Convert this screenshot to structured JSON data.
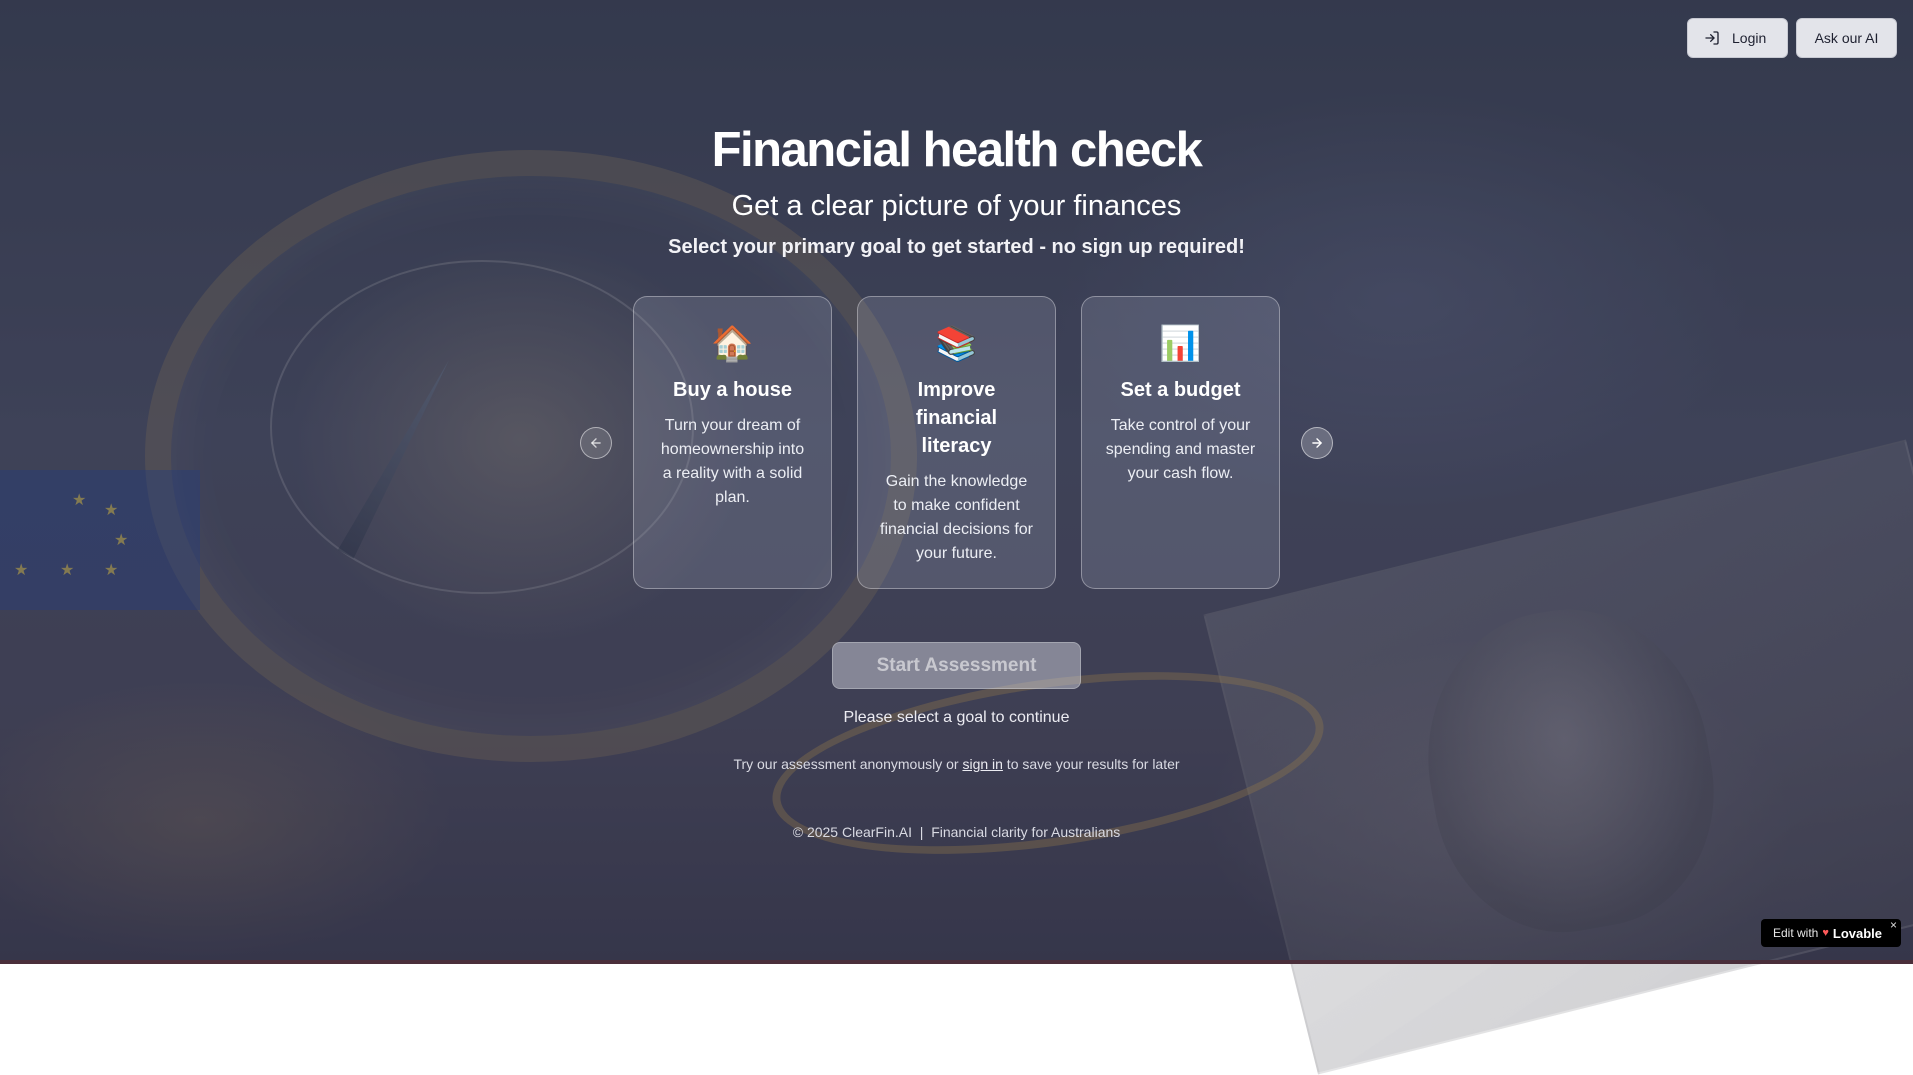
{
  "header": {
    "login_label": "Login",
    "ask_ai_label": "Ask our AI"
  },
  "hero": {
    "title": "Financial health check",
    "subtitle": "Get a clear picture of your finances",
    "instruction": "Select your primary goal to get started - no sign up required!"
  },
  "goals": [
    {
      "icon": "house-icon",
      "emoji": "🏠",
      "title": "Buy a house",
      "description": "Turn your dream of homeownership into a reality with a solid plan."
    },
    {
      "icon": "books-icon",
      "emoji": "📚",
      "title": "Improve financial literacy",
      "description": "Gain the knowledge to make confident financial decisions for your future."
    },
    {
      "icon": "bar-chart-icon",
      "emoji": "📊",
      "title": "Set a budget",
      "description": "Take control of your spending and master your cash flow."
    }
  ],
  "carousel": {
    "prev_icon": "arrow-left-icon",
    "next_icon": "arrow-right-icon"
  },
  "cta": {
    "start_label": "Start Assessment",
    "hint": "Please select a goal to continue"
  },
  "anon_note": {
    "before": "Try our assessment anonymously or ",
    "link": "sign in",
    "after": " to save your results for later"
  },
  "footer": {
    "text": "© 2025 ClearFin.AI  |  Financial clarity for Australians"
  },
  "badge": {
    "prefix": "Edit with",
    "brand": "Lovable",
    "close": "×"
  },
  "colors": {
    "overlay": "#2e3148",
    "button_bg": "#e3e4ea",
    "badge_bg": "#000000"
  }
}
